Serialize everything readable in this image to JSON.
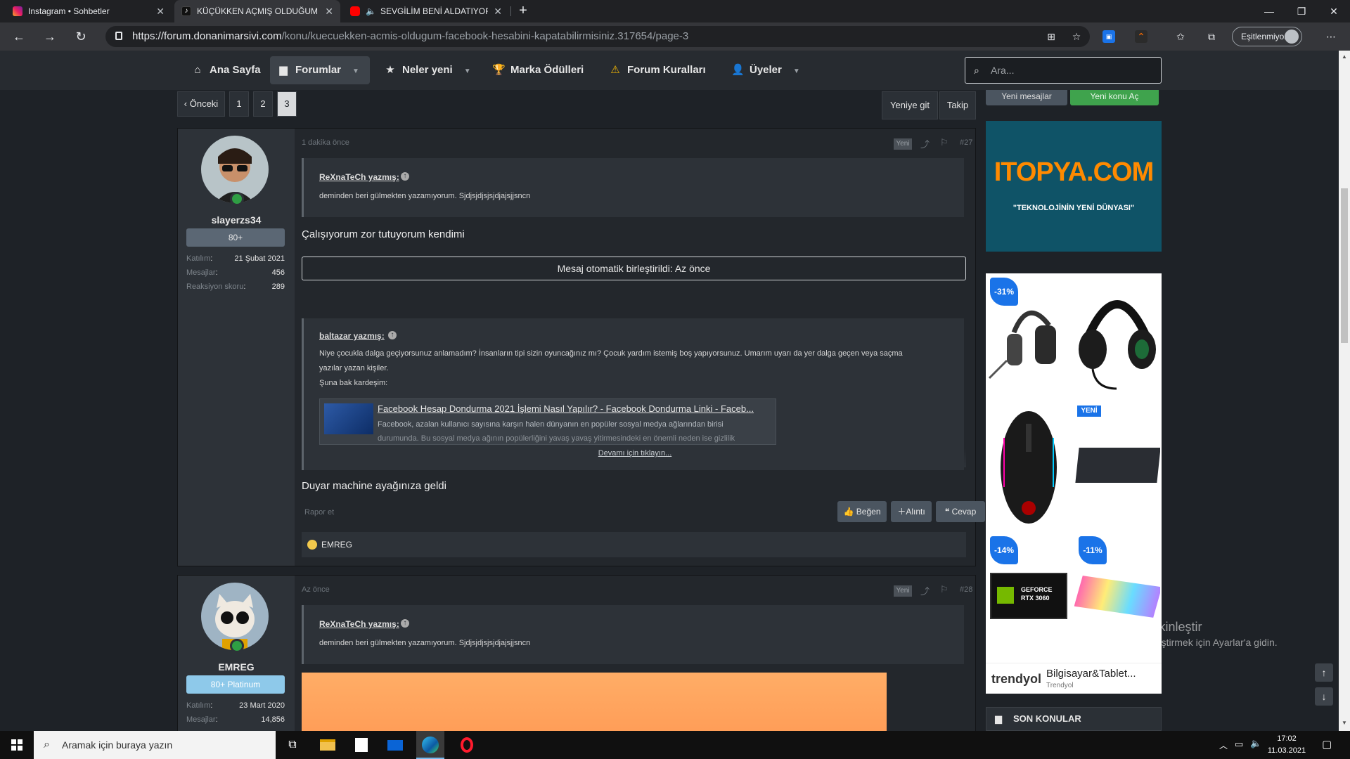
{
  "browser": {
    "tabs": [
      {
        "title": "Instagram • Sohbetler",
        "active": false
      },
      {
        "title": "KÜÇÜKKEN AÇMIŞ OLDUĞUM FA",
        "active": true
      },
      {
        "title": "SEVGİLİM BENİ ALDATIYOR",
        "active": false
      }
    ],
    "url_host": "https://forum.donanimarsivi.com",
    "url_path": "/konu/kuecuekken-acmis-oldugum-facebook-hesabini-kapatabilirmisiniz.317654/page-3",
    "profile_label": "Eşitlenmiyor"
  },
  "nav": {
    "items": [
      {
        "label": "Ana Sayfa",
        "icon": "home-icon"
      },
      {
        "label": "Forumlar",
        "icon": "comments-icon"
      },
      {
        "label": "Neler yeni",
        "icon": "star-icon"
      },
      {
        "label": "Marka Ödülleri",
        "icon": "trophy-icon"
      },
      {
        "label": "Forum Kuralları",
        "icon": "warning-icon"
      },
      {
        "label": "Üyeler",
        "icon": "user-icon"
      }
    ],
    "search_placeholder": "Ara..."
  },
  "pagination": {
    "prev": "‹ Önceki",
    "pages": [
      "1",
      "2",
      "3"
    ],
    "current": "3",
    "goto_new": "Yeniye git",
    "follow": "Takip"
  },
  "sidebar": {
    "new_message": "Yeni mesajlar",
    "new_topic": "Yeni konu Aç",
    "ad1_brand": "ITOPYA.COM",
    "ad1_tagline": "\"TEKNOLOJİNİN YENİ DÜNYASI\"",
    "ad2": {
      "discounts": [
        "-31%",
        "-14%",
        "-11%"
      ],
      "new_tag": "YENİ",
      "rtx_label": "GEFORCE RTX 3060",
      "brand": "trendyol",
      "title": "Bilgisayar&Tablet...",
      "subtitle": "Trendyol"
    },
    "recent_topics": "SON KONULAR"
  },
  "posts": [
    {
      "time": "1 dakika önce",
      "new": "Yeni",
      "number": "#27",
      "user": {
        "name": "slayerzs34",
        "badge": "80+",
        "stats": [
          {
            "k": "Katılım",
            "v": "21 Şubat 2021"
          },
          {
            "k": "Mesajlar",
            "v": "456"
          },
          {
            "k": "Reaksiyon skoru",
            "v": "289"
          }
        ]
      },
      "quote1": {
        "author": "ReXnaTeCh yazmış:",
        "text": "deminden beri gülmekten yazamıyorum. Sjdjsjdjsjsjdjajsjjsncn"
      },
      "text1": "Çalışıyorum zor tutuyorum kendimi",
      "merged": "Mesaj otomatik birleştirildi: Az önce",
      "quote2": {
        "author": "baltazar yazmış:",
        "line1": "Niye çocukla dalga geçiyorsunuz anlamadım? İnsanların tipi sizin oyuncağınız mı? Çocuk yardım istemiş boş yapıyorsunuz. Umarım uyarı da yer dalga geçen veya saçma",
        "line2": "yazılar yazan kişiler.",
        "line3": "Şuna bak kardeşim:",
        "link_title": "Facebook Hesap Dondurma 2021 İşlemi Nasıl Yapılır? - Facebook Dondurma Linki - Faceb...",
        "link_desc1": "Facebook, azalan kullanıcı sayısına karşın halen dünyanın en popüler sosyal medya ağlarından birisi",
        "link_desc2": "durumunda. Bu sosyal medya ağının popülerliğini yavaş yavaş yitirmesindeki en önemli neden ise gizlilik",
        "expand": "Devamı için tıklayın..."
      },
      "text2": "Duyar machine ayağınıza geldi",
      "report": "Rapor et",
      "actions": {
        "like": "Beğen",
        "quote": "Alıntı",
        "reply": "Cevap"
      },
      "reaction": "EMREG"
    },
    {
      "time": "Az önce",
      "new": "Yeni",
      "number": "#28",
      "user": {
        "name": "EMREG",
        "badge": "80+ Platinum",
        "stats": [
          {
            "k": "Katılım",
            "v": "23 Mart 2020"
          },
          {
            "k": "Mesajlar",
            "v": "14,856"
          }
        ]
      },
      "quote1": {
        "author": "ReXnaTeCh yazmış:",
        "text": "deminden beri gülmekten yazamıyorum. Sjdjsjdjsjsjdjajsjjsncn"
      }
    }
  ],
  "watermark": {
    "line1": "Windows'u Etkinleştir",
    "line2": "Windows'u etkinleştirmek için Ayarlar'a gidin."
  },
  "taskbar": {
    "search_placeholder": "Aramak için buraya yazın",
    "time": "17:02",
    "date": "11.03.2021"
  }
}
